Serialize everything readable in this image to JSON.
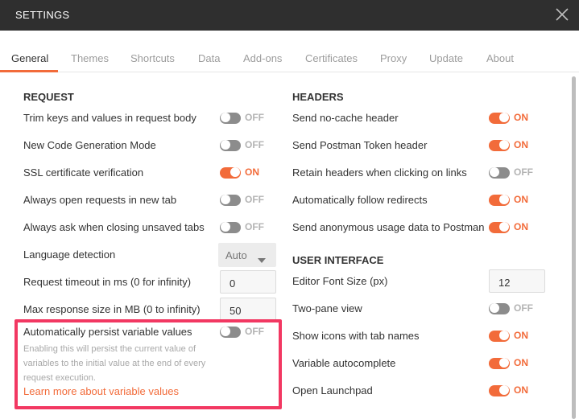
{
  "window": {
    "title": "SETTINGS",
    "close_icon": "close-icon"
  },
  "tabs": [
    {
      "label": "General",
      "active": true
    },
    {
      "label": "Themes",
      "active": false
    },
    {
      "label": "Shortcuts",
      "active": false
    },
    {
      "label": "Data",
      "active": false
    },
    {
      "label": "Add-ons",
      "active": false
    },
    {
      "label": "Certificates",
      "active": false
    },
    {
      "label": "Proxy",
      "active": false
    },
    {
      "label": "Update",
      "active": false
    },
    {
      "label": "About",
      "active": false
    }
  ],
  "request": {
    "heading": "REQUEST",
    "trim_keys": {
      "label": "Trim keys and values in request body",
      "state": "OFF"
    },
    "code_gen": {
      "label": "New Code Generation Mode",
      "state": "OFF"
    },
    "ssl": {
      "label": "SSL certificate verification",
      "state": "ON"
    },
    "new_tab": {
      "label": "Always open requests in new tab",
      "state": "OFF"
    },
    "ask_closing": {
      "label": "Always ask when closing unsaved tabs",
      "state": "OFF"
    },
    "language": {
      "label": "Language detection",
      "value": "Auto"
    },
    "timeout": {
      "label": "Request timeout in ms (0 for infinity)",
      "value": "0"
    },
    "max_size": {
      "label": "Max response size in MB (0 to infinity)",
      "value": "50"
    },
    "persist": {
      "label": "Automatically persist variable values",
      "state": "OFF",
      "description": "Enabling this will persist the current value of variables to the initial value at the end of every request execution.",
      "link": "Learn more about variable values"
    }
  },
  "headers": {
    "heading": "HEADERS",
    "no_cache": {
      "label": "Send no-cache header",
      "state": "ON"
    },
    "postman_token": {
      "label": "Send Postman Token header",
      "state": "ON"
    },
    "retain_headers": {
      "label": "Retain headers when clicking on links",
      "state": "OFF"
    },
    "follow_redirects": {
      "label": "Automatically follow redirects",
      "state": "ON"
    },
    "usage_data": {
      "label": "Send anonymous usage data to Postman",
      "state": "ON"
    }
  },
  "ui": {
    "heading": "USER INTERFACE",
    "font_size": {
      "label": "Editor Font Size (px)",
      "value": "12"
    },
    "two_pane": {
      "label": "Two-pane view",
      "state": "OFF"
    },
    "tab_icons": {
      "label": "Show icons with tab names",
      "state": "ON"
    },
    "autocomplete": {
      "label": "Variable autocomplete",
      "state": "ON"
    },
    "launchpad": {
      "label": "Open Launchpad",
      "state": "ON"
    }
  },
  "colors": {
    "accent": "#f26b3a",
    "highlight_border": "#f23862",
    "titlebar": "#2f2f2f"
  }
}
